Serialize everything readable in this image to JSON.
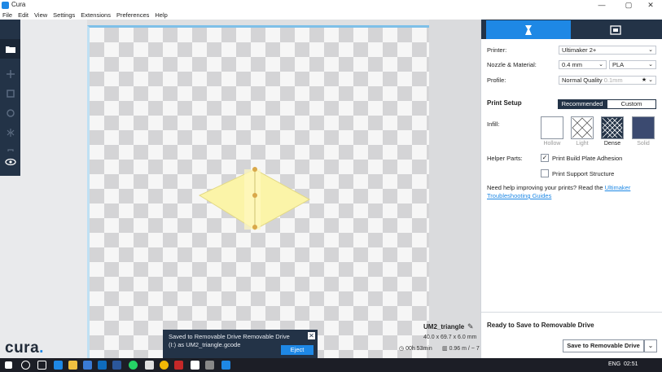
{
  "window": {
    "title": "Cura",
    "minimize": "—",
    "maximize": "▢",
    "close": "✕"
  },
  "menu": [
    "File",
    "Edit",
    "View",
    "Settings",
    "Extensions",
    "Preferences",
    "Help"
  ],
  "toolbar": {
    "open_icon": "folder-open-icon",
    "view_icon": "eye-icon",
    "view_chevron": "⌄"
  },
  "logo": {
    "text": "cura",
    "dot": "."
  },
  "toast": {
    "message": "Saved to Removable Drive Removable Drive (I:) as UM2_triangle.gcode",
    "close": "✕",
    "eject_label": "Eject"
  },
  "model_info": {
    "name": "UM2_triangle",
    "dimensions": "40.0 x 69.7 x 6.0 mm",
    "print_time": "00h 53min",
    "material": "0.96 m / ~ 7 g"
  },
  "sidebar": {
    "printer_label": "Printer:",
    "printer_value": "Ultimaker 2+",
    "nozzle_label": "Nozzle & Material:",
    "nozzle_value": "0.4 mm",
    "material_value": "PLA",
    "profile_label": "Profile:",
    "profile_value": "Normal Quality",
    "profile_layer": "0.1mm",
    "print_setup_label": "Print Setup",
    "recommended_label": "Recommended",
    "custom_label": "Custom",
    "infill_label": "Infill:",
    "infill_options": [
      "Hollow",
      "Light",
      "Dense",
      "Solid"
    ],
    "infill_selected": "Dense",
    "helper_label": "Helper Parts:",
    "build_plate_adhesion_label": "Print Build Plate Adhesion",
    "build_plate_adhesion_checked": true,
    "support_structure_label": "Print Support Structure",
    "support_structure_checked": false,
    "help_text": "Need help improving your prints? Read the ",
    "help_link": "Ultimaker Troubleshooting Guides",
    "ready_text": "Ready to Save to Removable Drive",
    "save_button": "Save to Removable Drive"
  },
  "taskbar": {
    "language": "ENG",
    "time": "02:51"
  },
  "colors": {
    "accent": "#1e88e5",
    "dark": "#233347",
    "model": "#fbf4a8"
  }
}
